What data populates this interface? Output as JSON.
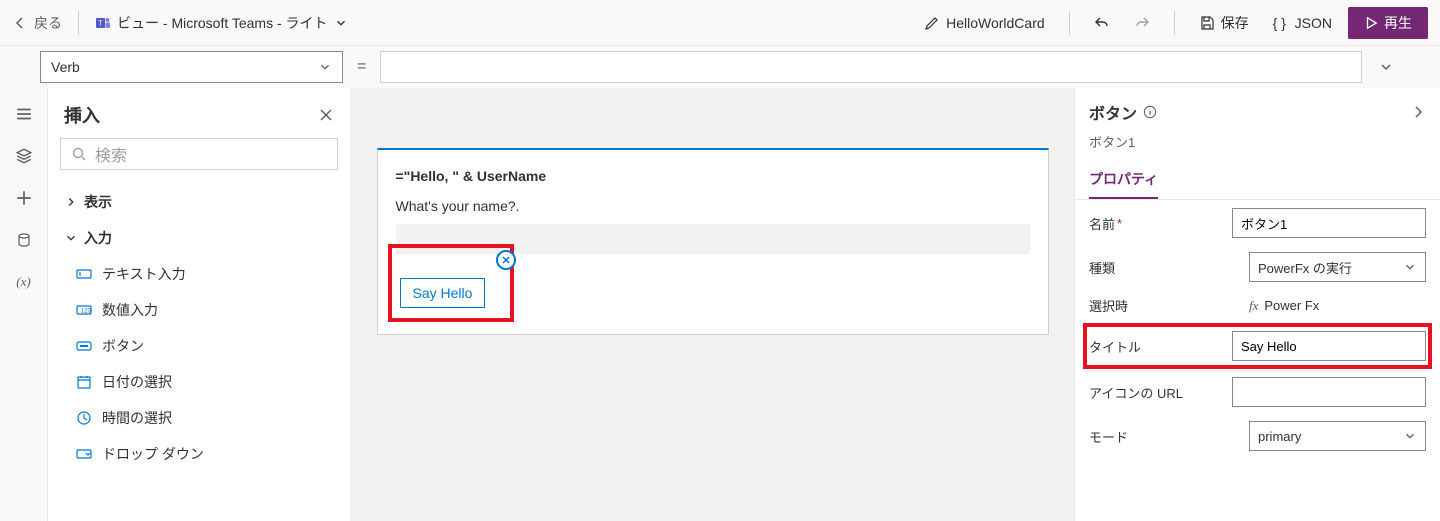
{
  "topbar": {
    "back_label": "戻る",
    "view_label": "ビュー - Microsoft Teams - ライト",
    "card_name": "HelloWorldCard",
    "save_label": "保存",
    "json_label": "JSON",
    "play_label": "再生"
  },
  "formula_bar": {
    "property_selected": "Verb",
    "expression": ""
  },
  "insert_panel": {
    "title": "挿入",
    "search_placeholder": "検索",
    "groups": {
      "display": {
        "label": "表示",
        "expanded": false
      },
      "input": {
        "label": "入力",
        "expanded": true
      }
    },
    "input_items": [
      {
        "icon": "text-input-icon",
        "label": "テキスト入力"
      },
      {
        "icon": "number-input-icon",
        "label": "数値入力"
      },
      {
        "icon": "button-icon",
        "label": "ボタン"
      },
      {
        "icon": "date-picker-icon",
        "label": "日付の選択"
      },
      {
        "icon": "time-picker-icon",
        "label": "時間の選択"
      },
      {
        "icon": "dropdown-icon",
        "label": "ドロップ ダウン"
      }
    ]
  },
  "canvas_card": {
    "title_formula": "=\"Hello, \" & UserName",
    "subtitle": "What's your name?.",
    "button_label": "Say Hello"
  },
  "props_panel": {
    "header": "ボタン",
    "instance_name": "ボタン1",
    "tab_properties": "プロパティ",
    "rows": {
      "name": {
        "label": "名前",
        "required": true,
        "value": "ボタン1"
      },
      "kind": {
        "label": "種類",
        "value": "PowerFx の実行"
      },
      "onselect": {
        "label": "選択時",
        "value": "Power Fx"
      },
      "title": {
        "label": "タイトル",
        "value": "Say Hello"
      },
      "iconurl": {
        "label": "アイコンの URL",
        "value": ""
      },
      "mode": {
        "label": "モード",
        "value": "primary"
      }
    }
  }
}
